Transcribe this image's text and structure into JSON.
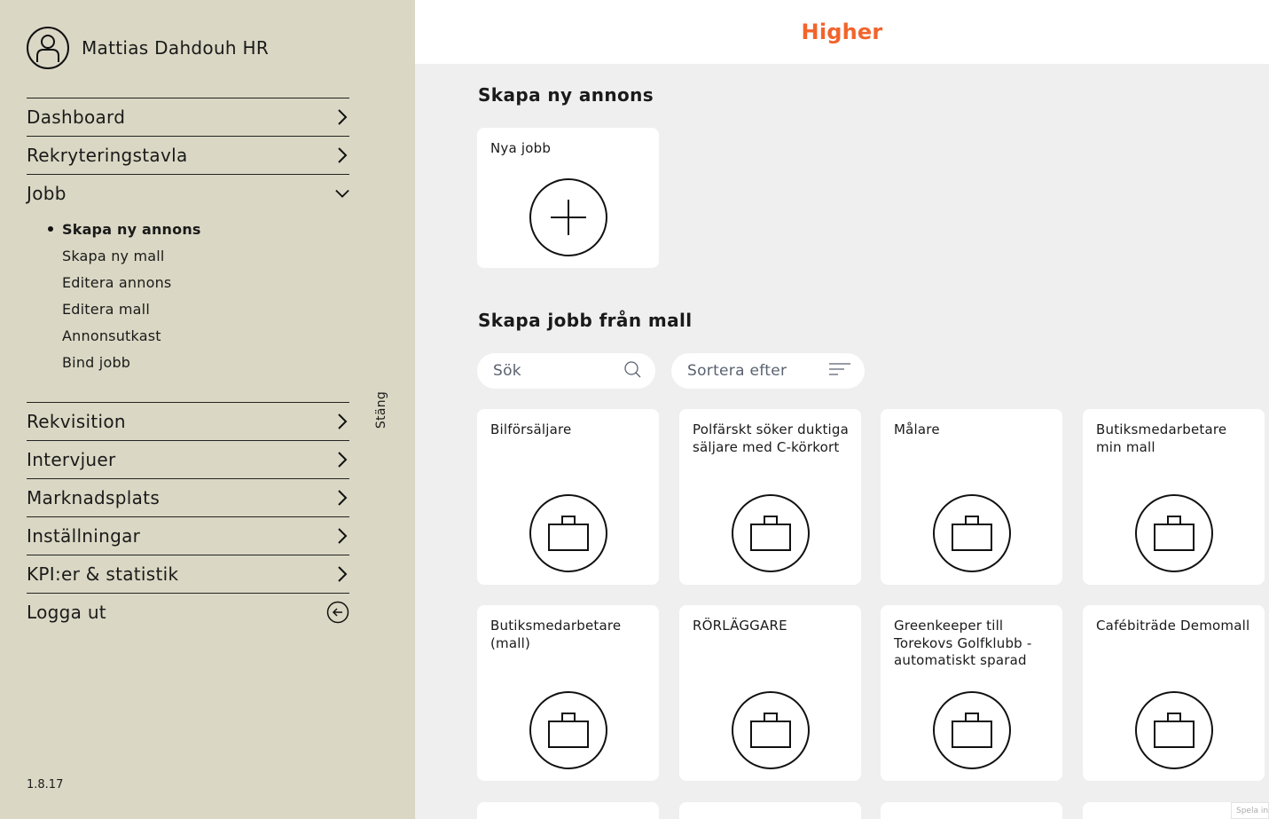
{
  "user": {
    "name": "Mattias Dahdouh HR",
    "icon": "user-avatar-icon"
  },
  "nav_top": [
    {
      "label": "Dashboard",
      "icon": "chevron-right-icon"
    },
    {
      "label": "Rekryteringstavla",
      "icon": "chevron-right-icon"
    },
    {
      "label": "Jobb",
      "icon": "chevron-down-icon"
    }
  ],
  "jobb_sub": [
    {
      "label": "Skapa ny annons",
      "active": true
    },
    {
      "label": "Skapa ny mall"
    },
    {
      "label": "Editera annons"
    },
    {
      "label": "Editera mall"
    },
    {
      "label": "Annonsutkast"
    },
    {
      "label": "Bind jobb"
    }
  ],
  "nav_bottom": [
    {
      "label": "Rekvisition",
      "icon": "chevron-right-icon"
    },
    {
      "label": "Intervjuer",
      "icon": "chevron-right-icon"
    },
    {
      "label": "Marknadsplats",
      "icon": "chevron-right-icon"
    },
    {
      "label": "Inställningar",
      "icon": "chevron-right-icon"
    },
    {
      "label": "KPI:er & statistik",
      "icon": "chevron-right-icon"
    },
    {
      "label": "Logga ut",
      "icon": "arrow-left-circle-icon"
    }
  ],
  "sidebar_close": "Stäng",
  "version": "1.8.17",
  "header": {
    "logo": "Higher",
    "logo_color": "#f2642c"
  },
  "create_section": {
    "title": "Skapa ny annons",
    "new_card_label": "Nya jobb",
    "icon": "plus-icon"
  },
  "template_section": {
    "title": "Skapa jobb från mall",
    "search_placeholder": "Sök",
    "sort_label": "Sortera efter",
    "templates": [
      "Bilförsäljare",
      "Polfärskt söker duktiga säljare med C-körkort",
      "Målare",
      "Butiksmedarbetare min mall",
      "Butiksmedarbetare (mall)",
      "RÖRLÄGGARE",
      "Greenkeeper till Torekovs Golfklubb - automatiskt sparad",
      "Cafébiträde Demomall"
    ],
    "template_icon": "briefcase-icon"
  },
  "corner_note": "Spela in"
}
